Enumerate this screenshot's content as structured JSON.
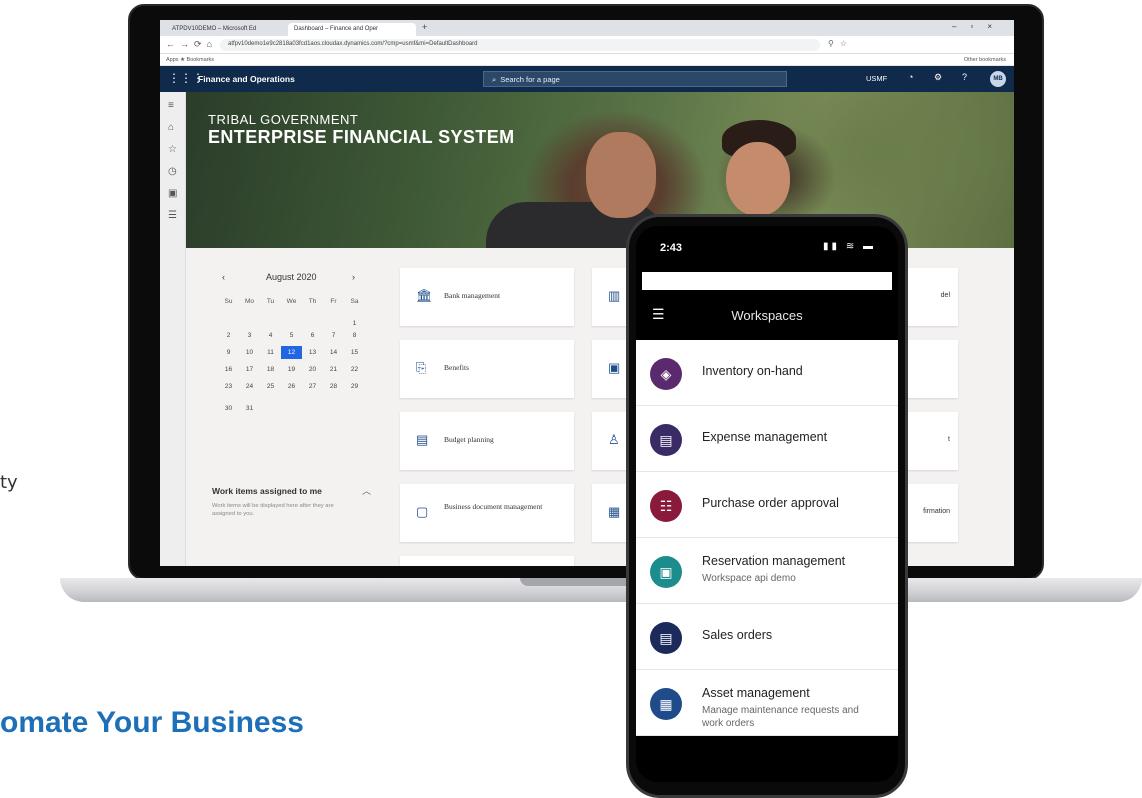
{
  "page": {
    "fragment_left": "ty",
    "fragment_heading": "omate Your Business"
  },
  "browser": {
    "tab1": "ATPDV10DEMO – Microsoft Ed",
    "tab2": "Dashboard – Finance and Oper",
    "url": "atfpv10demo1e9c2818a03fcd1aos.cloudax.dynamics.com/?cmp=usmf&mi=DefaultDashboard",
    "bookmarks_left": "Apps  ★ Bookmarks",
    "bookmarks_right": "Other bookmarks"
  },
  "d365": {
    "app_title": "Finance and Operations",
    "search_placeholder": "Search for a page",
    "company": "USMF",
    "avatar": "MB"
  },
  "hero": {
    "subtitle": "TRIBAL GOVERNMENT",
    "title": "ENTERPRISE FINANCIAL SYSTEM"
  },
  "calendar": {
    "month": "August  2020",
    "days": [
      "Su",
      "Mo",
      "Tu",
      "We",
      "Th",
      "Fr",
      "Sa"
    ],
    "rows": [
      [
        "",
        "",
        "",
        "",
        "",
        "",
        "1"
      ],
      [
        "2",
        "3",
        "4",
        "5",
        "6",
        "7",
        "8"
      ],
      [
        "9",
        "10",
        "11",
        "12",
        "13",
        "14",
        "15"
      ],
      [
        "16",
        "17",
        "18",
        "19",
        "20",
        "21",
        "22"
      ],
      [
        "23",
        "24",
        "25",
        "26",
        "27",
        "28",
        "29"
      ],
      [
        "30",
        "31",
        "",
        "",
        "",
        "",
        ""
      ]
    ],
    "selected": "12"
  },
  "work_items": {
    "title": "Work items assigned to me",
    "empty": "Work items will be displayed here after they are assigned to you."
  },
  "tiles": {
    "bank": "Bank management",
    "benefits": "Benefits",
    "budget": "Budget planning",
    "business_doc": "Business document management",
    "frag_del": "del",
    "frag_t": "t",
    "frag_firmation": "firmation"
  },
  "phone": {
    "time": "2:43",
    "header": "Workspaces",
    "items": [
      {
        "label": "Inventory on-hand",
        "sub": "",
        "color": "#5b2a6e"
      },
      {
        "label": "Expense management",
        "sub": "",
        "color": "#3a2a66"
      },
      {
        "label": "Purchase order approval",
        "sub": "",
        "color": "#8a1a3c"
      },
      {
        "label": "Reservation management",
        "sub": "Workspace api demo",
        "color": "#1d8c8c"
      },
      {
        "label": "Sales orders",
        "sub": "",
        "color": "#1b2a5a"
      },
      {
        "label": "Asset management",
        "sub": "Manage maintenance requests and work orders",
        "color": "#1f4b8a"
      }
    ]
  },
  "colors": {
    "accent": "#1d6fb8",
    "nav_bar": "#0f2a4a",
    "calendar_selected": "#2266e3"
  }
}
